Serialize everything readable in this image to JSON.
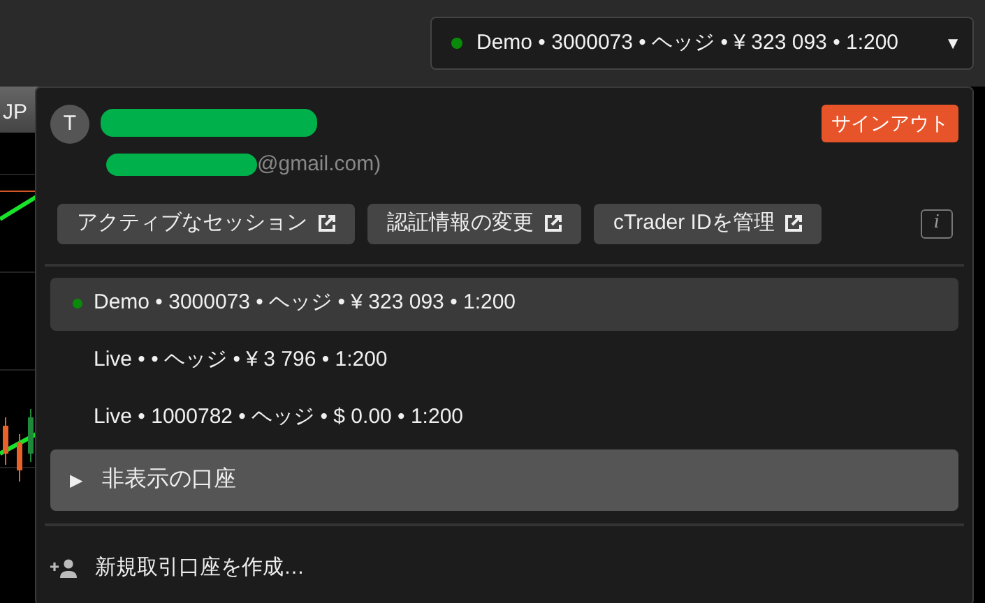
{
  "chart_tab": {
    "label": "JP"
  },
  "account_selector": {
    "connected": true,
    "label": "Demo • 3000073 • ヘッジ • ¥ 323 093 • 1:200",
    "caret": "▼",
    "expanded": true
  },
  "user": {
    "avatar_initial": "T",
    "name_redacted": true,
    "email_redacted": true,
    "email_visible": "@gmail.com)"
  },
  "sign_out": "サインアウト",
  "links": [
    {
      "label": "アクティブなセッション"
    },
    {
      "label": "認証情報の変更"
    },
    {
      "label": "cTrader IDを管理"
    }
  ],
  "info": "i",
  "accounts": [
    {
      "label": "Demo • 3000073 • ヘッジ • ¥ 323 093 • 1:200",
      "selected": true,
      "connected": true
    },
    {
      "label": "Live •  • ヘッジ • ¥ 3 796 • 1:200",
      "selected": false,
      "connected": false
    },
    {
      "label": "Live • 1000782 • ヘッジ • $ 0.00 • 1:200",
      "selected": false,
      "connected": false
    }
  ],
  "hidden_accounts": {
    "toggle": "▶",
    "label": "非表示の口座",
    "expanded": false
  },
  "create_account": {
    "label": "新規取引口座を作成…"
  }
}
